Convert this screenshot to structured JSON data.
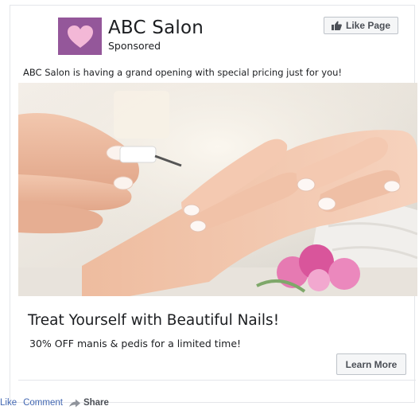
{
  "post": {
    "page_name": "ABC Salon",
    "sponsored_label": "Sponsored",
    "like_page_label": "Like Page",
    "body_text": "ABC Salon is having a grand opening with special pricing just for you!"
  },
  "ad": {
    "headline": "Treat Yourself with Beautiful Nails!",
    "description": "30% OFF manis & pedis for a limited time!",
    "cta_label": "Learn More"
  },
  "actions": {
    "like": "Like",
    "comment": "Comment",
    "share": "Share"
  },
  "icons": {
    "avatar": "heart-icon",
    "like_page": "thumbs-up-icon",
    "share": "share-arrow-icon"
  },
  "colors": {
    "avatar_bg": "#94579a",
    "link": "#4267b2",
    "button_bg": "#f5f6f7",
    "button_border": "#bec3c9",
    "text": "#1c1e21"
  }
}
